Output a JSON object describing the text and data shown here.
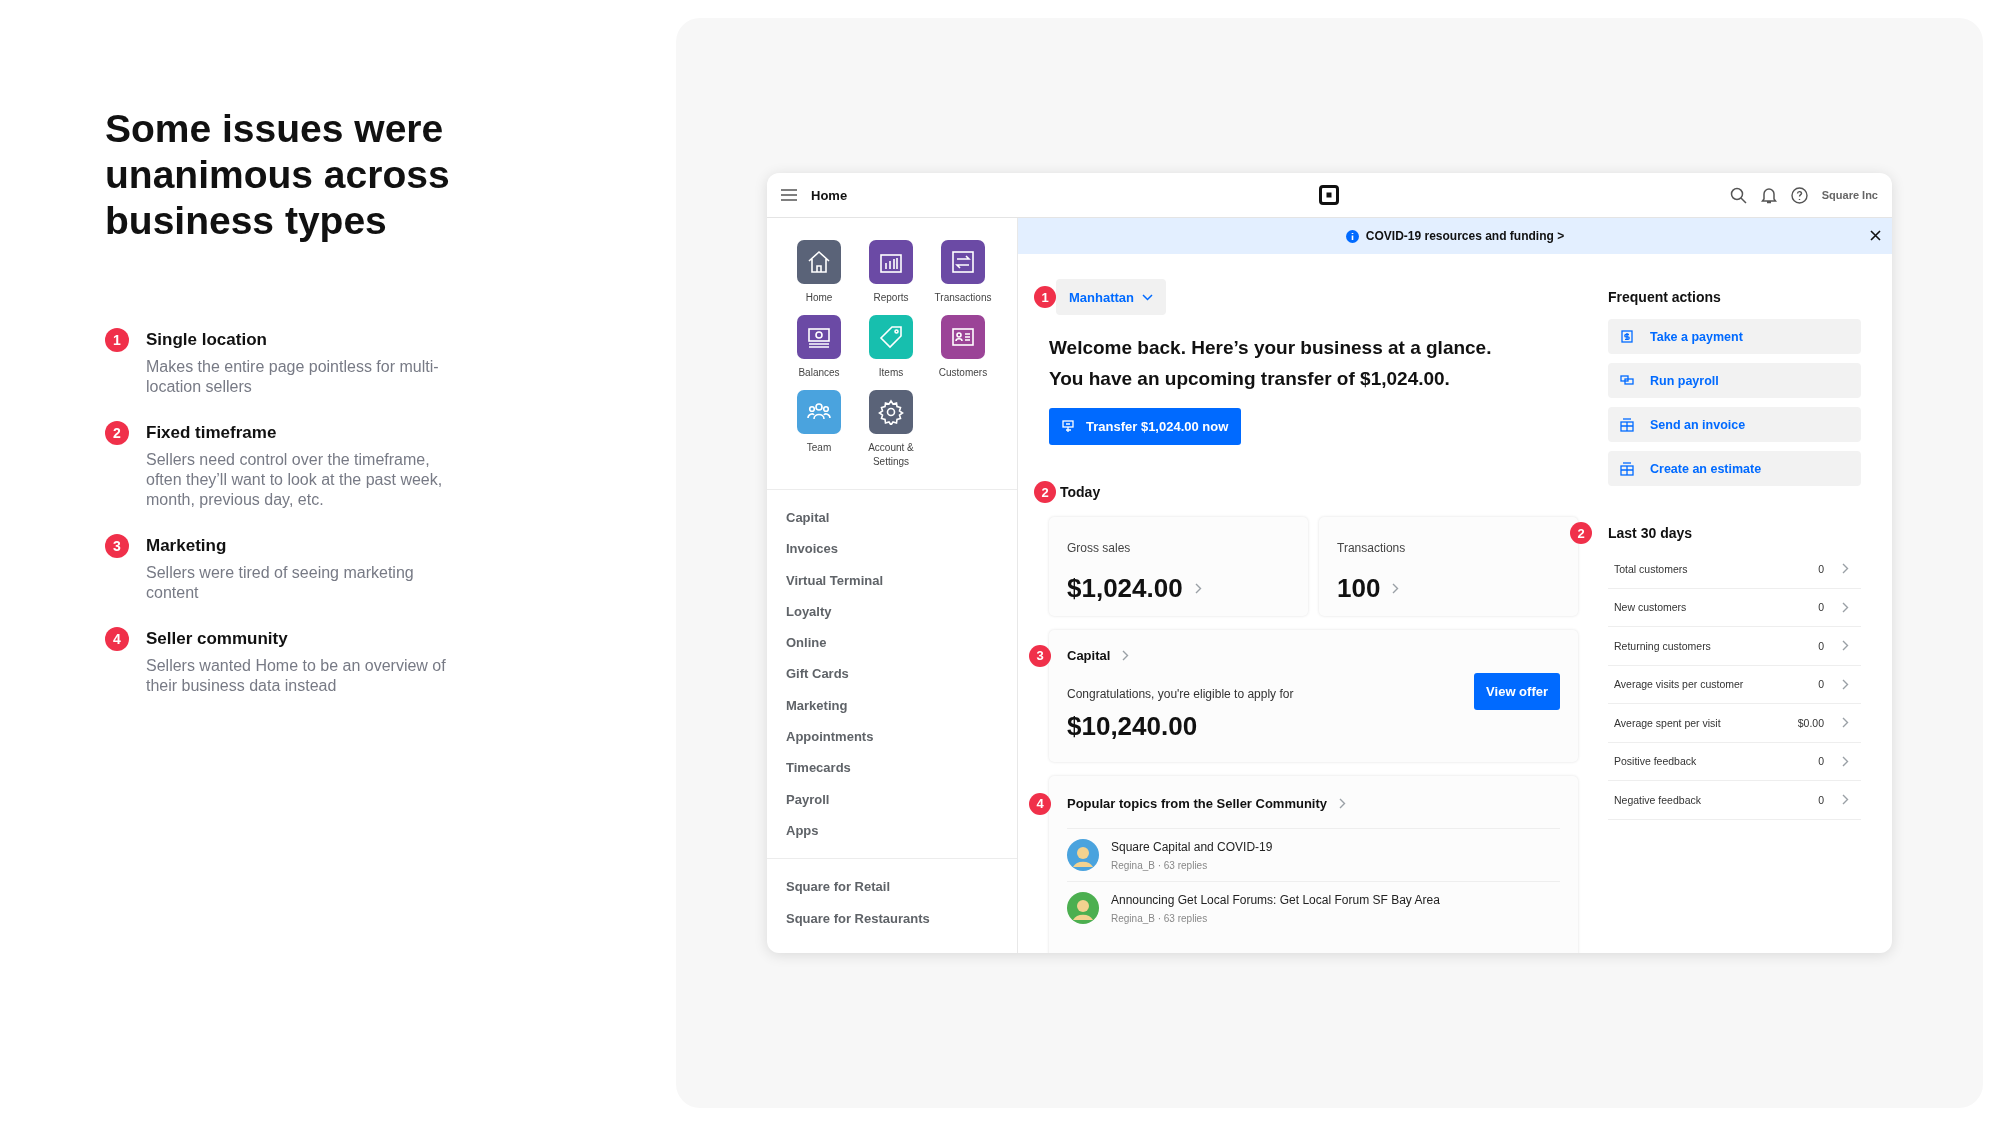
{
  "heading": "Some issues were unanimous across business types",
  "issues": [
    {
      "number": "1",
      "title": "Single location",
      "description": "Makes the entire page pointless for multi-location sellers"
    },
    {
      "number": "2",
      "title": "Fixed timeframe",
      "description": "Sellers need control over the timeframe, often they’ll want to look at the past week, month, previous day, etc."
    },
    {
      "number": "3",
      "title": "Marketing",
      "description": "Sellers were tired of seeing marketing content"
    },
    {
      "number": "4",
      "title": "Seller community",
      "description": "Sellers wanted Home to be an overview of their business data instead"
    }
  ],
  "app": {
    "header": {
      "title": "Home",
      "account": "Square Inc"
    },
    "launcher": [
      {
        "label": "Home",
        "kind": "home",
        "color": "#5a6378"
      },
      {
        "label": "Reports",
        "kind": "reports",
        "color": "#6b4aa5"
      },
      {
        "label": "Transactions",
        "kind": "transactions",
        "color": "#6b4aa5"
      },
      {
        "label": "Balances",
        "kind": "balances",
        "color": "#6b4aa5"
      },
      {
        "label": "Items",
        "kind": "items",
        "color": "#17bfae"
      },
      {
        "label": "Customers",
        "kind": "customers",
        "color": "#9b4497"
      },
      {
        "label": "Team",
        "kind": "team",
        "color": "#4aa3de"
      },
      {
        "label": "Account & Settings",
        "kind": "settings",
        "color": "#5a6378"
      }
    ],
    "nav": [
      "Capital",
      "Invoices",
      "Virtual Terminal",
      "Loyalty",
      "Online",
      "Gift Cards",
      "Marketing",
      "Appointments",
      "Timecards",
      "Payroll",
      "Apps"
    ],
    "nav_secondary": [
      "Square for Retail",
      "Square for Restaurants"
    ],
    "banner": "COVID-19 resources and funding >",
    "location": {
      "marker": "1",
      "label": "Manhattan"
    },
    "welcome": [
      "Welcome back. Here’s your business at a glance.",
      "You have an upcoming transfer of $1,024.00."
    ],
    "transfer_button": "Transfer $1,024.00 now",
    "today": {
      "marker": "2",
      "title": "Today",
      "stats": [
        {
          "label": "Gross sales",
          "value": "$1,024.00"
        },
        {
          "label": "Transactions",
          "value": "100"
        }
      ]
    },
    "capital": {
      "marker": "3",
      "title": "Capital",
      "text": "Congratulations, you're eligible to apply for",
      "amount": "$10,240.00",
      "button": "View offer"
    },
    "community": {
      "marker": "4",
      "title": "Popular topics from the Seller Community",
      "topics": [
        {
          "title": "Square Capital and COVID-19",
          "meta": "Regina_B · 63 replies",
          "color": "#4aa3de"
        },
        {
          "title": "Announcing Get Local Forums: Get Local Forum SF Bay Area",
          "meta": "Regina_B · 63 replies",
          "color": "#4caf50"
        }
      ]
    },
    "frequent_actions": {
      "title": "Frequent actions",
      "actions": [
        {
          "label": "Take a payment",
          "kind": "payment"
        },
        {
          "label": "Run payroll",
          "kind": "payroll"
        },
        {
          "label": "Send an invoice",
          "kind": "invoice"
        },
        {
          "label": "Create an estimate",
          "kind": "invoice"
        }
      ]
    },
    "last_30_days": {
      "marker": "2",
      "title": "Last 30 days",
      "rows": [
        {
          "label": "Total customers",
          "value": "0"
        },
        {
          "label": "New customers",
          "value": "0"
        },
        {
          "label": "Returning customers",
          "value": "0"
        },
        {
          "label": "Average visits per customer",
          "value": "0"
        },
        {
          "label": "Average spent per visit",
          "value": "$0.00"
        },
        {
          "label": "Positive feedback",
          "value": "0"
        },
        {
          "label": "Negative feedback",
          "value": "0"
        }
      ]
    }
  }
}
